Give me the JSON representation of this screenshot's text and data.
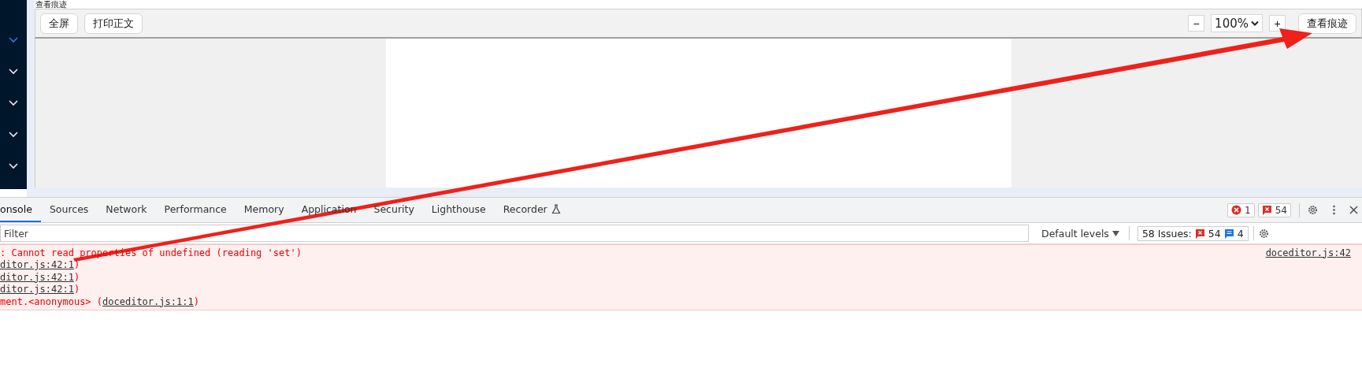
{
  "page": {
    "title": "查看痕迹"
  },
  "sidebar": {
    "items": [
      {
        "selected": true
      },
      {
        "selected": false
      },
      {
        "selected": false
      },
      {
        "selected": false
      },
      {
        "selected": false
      }
    ]
  },
  "toolbar": {
    "buttons": [
      "全屏",
      "打印正文"
    ],
    "zoom_out": "−",
    "zoom": "100%",
    "zoom_in": "+",
    "track_button": "查看痕迹"
  },
  "devtools": {
    "tabs": [
      {
        "label": "onsole",
        "selected": true
      },
      {
        "label": "Sources",
        "selected": false
      },
      {
        "label": "Network",
        "selected": false
      },
      {
        "label": "Performance",
        "selected": false
      },
      {
        "label": "Memory",
        "selected": false
      },
      {
        "label": "Application",
        "selected": false
      },
      {
        "label": "Security",
        "selected": false
      },
      {
        "label": "Lighthouse",
        "selected": false
      },
      {
        "label": "Recorder",
        "selected": false,
        "experimental": true
      }
    ],
    "error_count": "1",
    "issue_count": "54",
    "filter": {
      "placeholder": "Filter"
    },
    "levels": "Default levels",
    "issues": {
      "label": "58 Issues:",
      "errors": "54",
      "info": "4"
    },
    "messages": [
      {
        "prefix": ": Cannot read properties of undefined (reading 'set')",
        "source": "doceditor.js:42"
      },
      {
        "link": "ditor.js:42:1",
        "suffix": ")"
      },
      {
        "link": "ditor.js:42:1",
        "suffix": ")"
      },
      {
        "link": "ditor.js:42:1",
        "suffix": ")"
      },
      {
        "prefix": "ment.<anonymous> (",
        "link": "doceditor.js:1:1",
        "suffix": ")"
      }
    ]
  }
}
